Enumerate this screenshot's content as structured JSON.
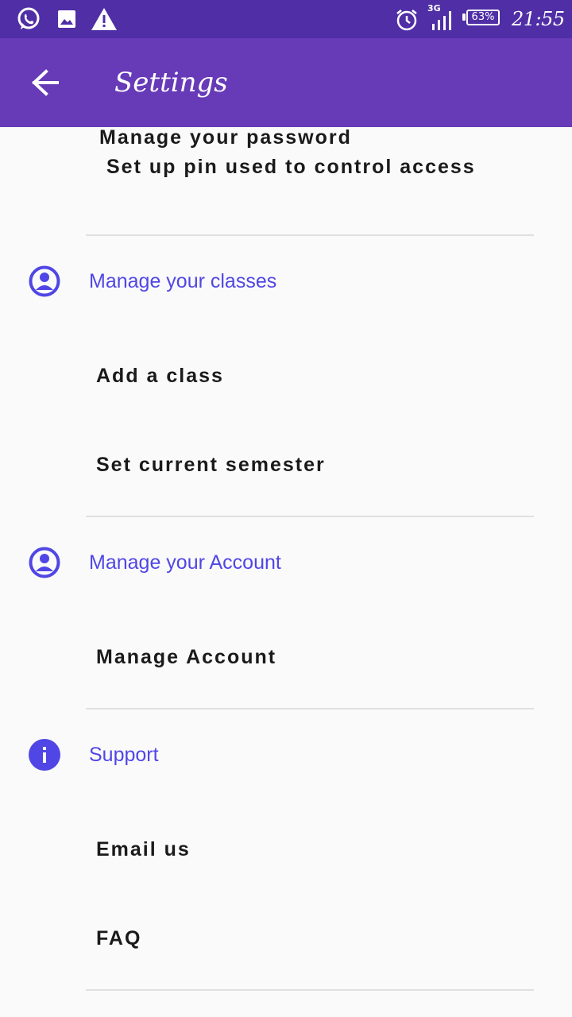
{
  "status_bar": {
    "icons": [
      "whatsapp-icon",
      "image-icon",
      "warning-icon",
      "alarm-icon",
      "signal-3g-icon",
      "battery-icon"
    ],
    "network": "3G",
    "battery": "63%",
    "time": "21:55"
  },
  "app_bar": {
    "back_icon": "arrow-back-icon",
    "title": "Settings"
  },
  "security": {
    "items": [
      "Manage your password",
      "Set up pin used to control access"
    ]
  },
  "sections": [
    {
      "icon": "account-circle-icon",
      "title": "Manage your classes",
      "items": [
        "Add a class",
        "Set current semester"
      ]
    },
    {
      "icon": "account-circle-icon",
      "title": "Manage your Account",
      "items": [
        "Manage Account"
      ]
    },
    {
      "icon": "info-icon",
      "title": "Support",
      "items": [
        "Email us",
        "FAQ"
      ]
    }
  ],
  "colors": {
    "status_bar": "#4f2ea6",
    "app_bar": "#673ab7",
    "accent": "#5046e5",
    "background": "#fafafa",
    "divider": "#e0e0e0"
  }
}
